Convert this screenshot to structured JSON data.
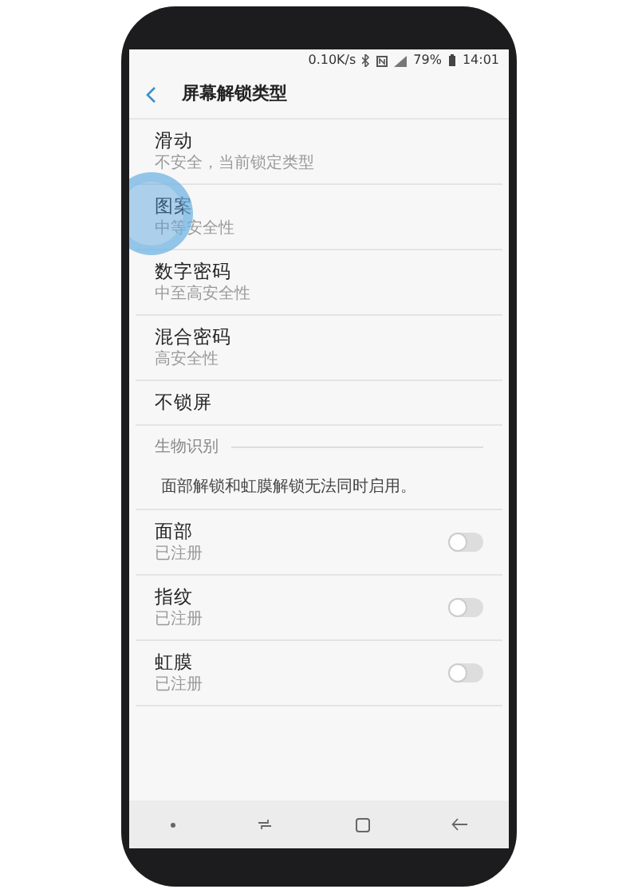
{
  "status_bar": {
    "speed": "0.10K/s",
    "battery": "79%",
    "time": "14:01"
  },
  "header": {
    "title": "屏幕解锁类型"
  },
  "lock_types": [
    {
      "title": "滑动",
      "subtitle": "不安全，当前锁定类型",
      "pressed": false
    },
    {
      "title": "图案",
      "subtitle": "中等安全性",
      "pressed": true
    },
    {
      "title": "数字密码",
      "subtitle": "中至高安全性",
      "pressed": false
    },
    {
      "title": "混合密码",
      "subtitle": "高安全性",
      "pressed": false
    },
    {
      "title": "不锁屏",
      "pressed": false
    }
  ],
  "section": {
    "title": "生物识别",
    "note": "面部解锁和虹膜解锁无法同时启用。"
  },
  "biometrics": [
    {
      "title": "面部",
      "subtitle": "已注册",
      "on": false
    },
    {
      "title": "指纹",
      "subtitle": "已注册",
      "on": false
    },
    {
      "title": "虹膜",
      "subtitle": "已注册",
      "on": false
    }
  ]
}
